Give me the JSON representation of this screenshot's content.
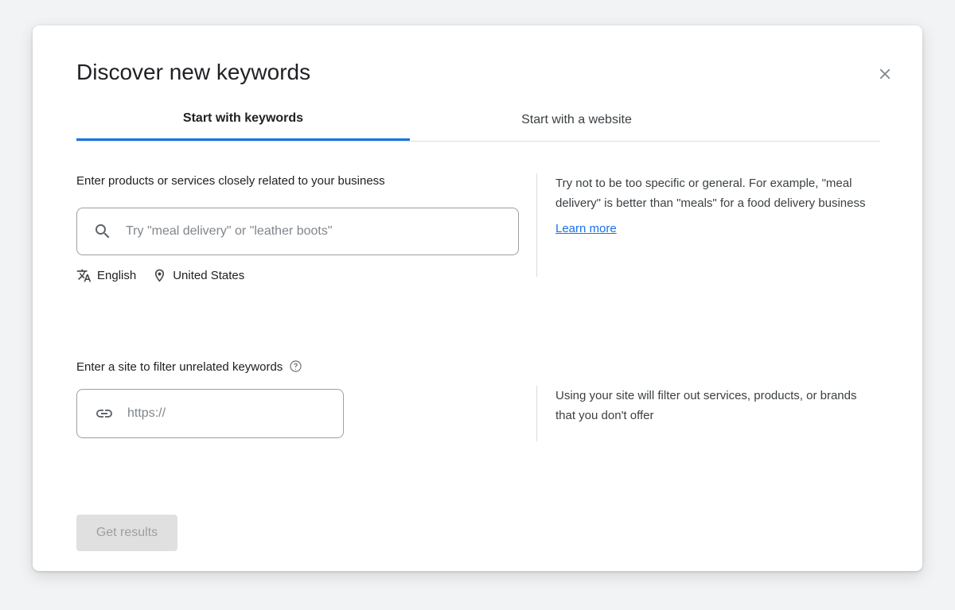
{
  "dialog": {
    "title": "Discover new keywords",
    "close_icon": "close-icon"
  },
  "tabs": [
    {
      "label": "Start with keywords",
      "active": true
    },
    {
      "label": "Start with a website",
      "active": false
    }
  ],
  "keywords_section": {
    "label": "Enter products or services closely related to your business",
    "search_icon": "search-icon",
    "input_value": "",
    "placeholder": "Try \"meal delivery\" or \"leather boots\"",
    "language": {
      "icon": "translate-icon",
      "label": "English"
    },
    "location": {
      "icon": "location-pin-icon",
      "label": "United States"
    },
    "helper": {
      "text": "Try not to be too specific or general. For example, \"meal delivery\" is better than \"meals\" for a food delivery business",
      "link_label": "Learn more"
    }
  },
  "site_section": {
    "label": "Enter a site to filter unrelated keywords",
    "help_icon": "help-circle-icon",
    "link_icon": "link-icon",
    "input_value": "",
    "placeholder": "https://",
    "helper": {
      "text": "Using your site will filter out services, products, or brands that you don't offer"
    }
  },
  "footer": {
    "submit_label": "Get results",
    "submit_disabled": true
  },
  "colors": {
    "accent": "#1a73e8",
    "page_background": "#f1f3f4",
    "surface": "#ffffff",
    "text_primary": "#202124",
    "text_secondary": "#3c4043",
    "placeholder": "#80868b",
    "border": "#dadce0",
    "input_border": "#9aa0a6",
    "disabled_button_bg": "#e0e0e0",
    "disabled_button_text": "#9e9e9e"
  }
}
